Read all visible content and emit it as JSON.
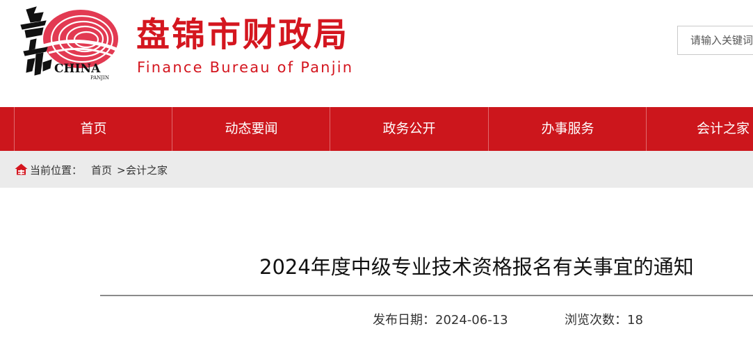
{
  "header": {
    "logo_alt": "盘锦 CHINA PANJIN",
    "title": "盘锦市财政局",
    "subtitle": "Finance Bureau of Panjin",
    "search": {
      "placeholder": "请输入关键词"
    }
  },
  "nav": {
    "items": [
      {
        "label": "首页"
      },
      {
        "label": "动态要闻"
      },
      {
        "label": "政务公开"
      },
      {
        "label": "办事服务"
      },
      {
        "label": "会计之家"
      }
    ]
  },
  "breadcrumb": {
    "label": "当前位置：",
    "home": "首页",
    "separator": ">",
    "current": "会计之家"
  },
  "article": {
    "title": "2024年度中级专业技术资格报名有关事宜的通知",
    "date_label": "发布日期：",
    "date": "2024-06-13",
    "views_label": "浏览次数：",
    "views": "18"
  },
  "colors": {
    "brand_red": "#cc161c",
    "title_red": "#d4161f",
    "breadcrumb_bg": "#ebebeb"
  },
  "icons": {
    "breadcrumb": "home-icon"
  }
}
